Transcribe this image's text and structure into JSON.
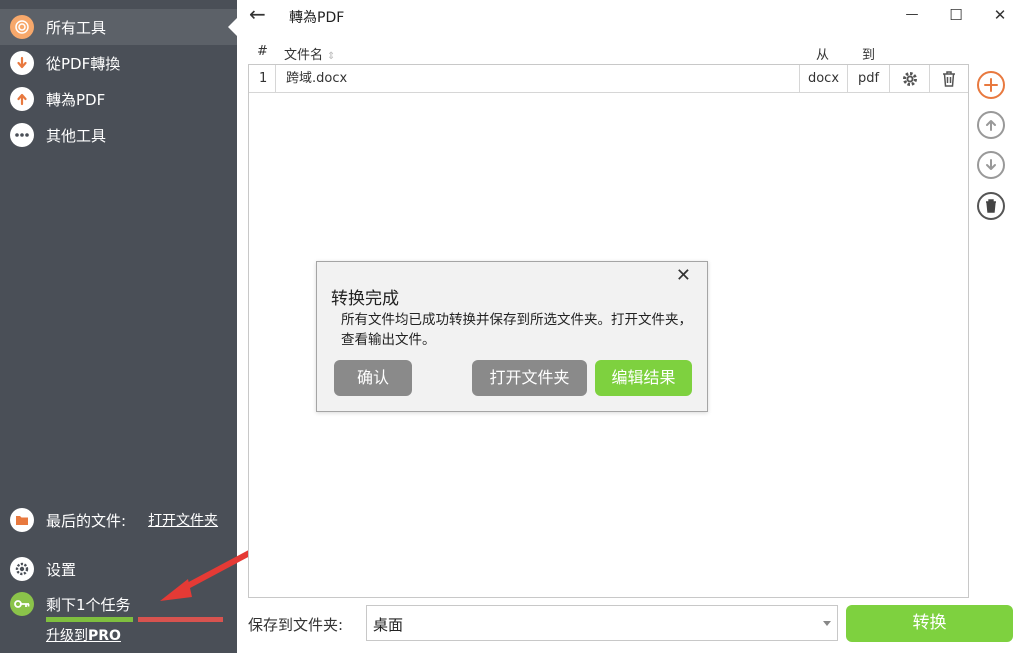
{
  "sidebar": {
    "items": [
      {
        "label": "所有工具",
        "icon": "all-tools-icon"
      },
      {
        "label": "從PDF轉換",
        "icon": "from-pdf-icon"
      },
      {
        "label": "轉為PDF",
        "icon": "to-pdf-icon"
      },
      {
        "label": "其他工具",
        "icon": "more-icon"
      }
    ],
    "recent_label": "最后的文件:",
    "open_folder_link": "打开文件夹",
    "settings_label": "设置",
    "tasks_label": "剩下1个任务",
    "upgrade_prefix": "升级到",
    "upgrade_pro": "PRO"
  },
  "header": {
    "title": "轉為PDF",
    "back_glyph": "←",
    "minimize_glyph": "—",
    "maximize_glyph": "☐",
    "close_glyph": "✕"
  },
  "table": {
    "columns": {
      "index": "#",
      "filename": "文件名",
      "from": "从",
      "to": "到"
    },
    "rows": [
      {
        "index": "1",
        "filename": "跨域.docx",
        "from": "docx",
        "to": "pdf"
      }
    ]
  },
  "footer": {
    "save_label": "保存到文件夹:",
    "save_value": "桌面",
    "convert_label": "转换"
  },
  "dialog": {
    "title": "转换完成",
    "message": "所有文件均已成功转换并保存到所选文件夹。打开文件夹，查看输出文件。",
    "confirm_label": "确认",
    "open_folder_label": "打开文件夹",
    "edit_result_label": "编辑结果",
    "close_glyph": "✕"
  },
  "colors": {
    "sidebar_bg": "#4a4f57",
    "accent_green": "#7ed13f",
    "accent_orange": "#e8793f",
    "progress_done": "#7fbf3f",
    "progress_remaining": "#d8534f",
    "arrow_red": "#e53a35"
  },
  "task_progress": 0.5
}
